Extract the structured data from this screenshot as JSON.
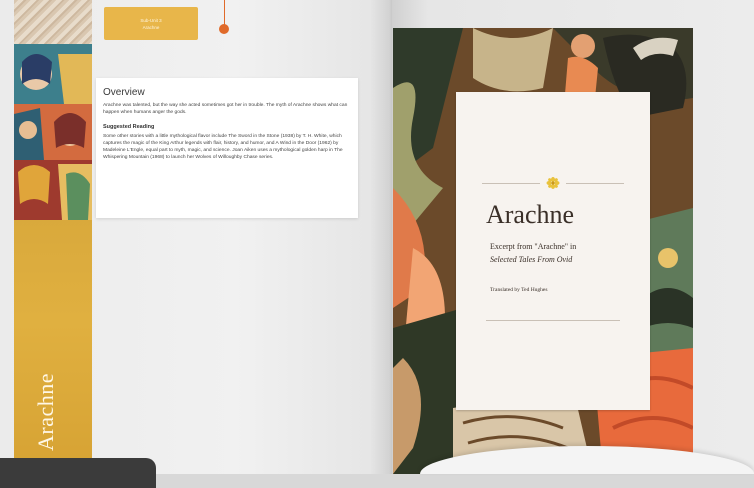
{
  "left_page": {
    "unit_tab": {
      "line1": "Sub-Unit 3",
      "line2": "Arachne"
    },
    "spine_title": "Arachne",
    "overview": {
      "heading": "Overview",
      "intro": "Arachne was talented, but the way she acted sometimes got her in trouble. The myth of Arachne shows what can happen when humans anger the gods.",
      "suggested_heading": "Suggested Reading",
      "suggested_body": "Some other stories with a little mythological flavor include The Sword in the Stone (1938) by T. H. White, which captures the magic of the King Arthur legends with flair, history, and humor, and A Wind in the Door (1962) by Madeleine L'Engle, equal part to myth, magic, and science. Joan Aiken uses a mythological golden harp in The Whispering Mountain (1968) to launch her Wolves of Willoughby Chase series."
    }
  },
  "right_page": {
    "title": "Arachne",
    "excerpt_line1": "Excerpt from \"Arachne\" in",
    "excerpt_line2": "Selected Tales From Ovid",
    "translator": "Translated by Ted Hughes"
  },
  "colors": {
    "tab_gold": "#e8b64a",
    "spine_gold": "#d9a93c",
    "pointer_orange": "#e06a2a",
    "card_bg": "#f7f3ef"
  },
  "icons": [
    "flower-ornament-icon"
  ]
}
